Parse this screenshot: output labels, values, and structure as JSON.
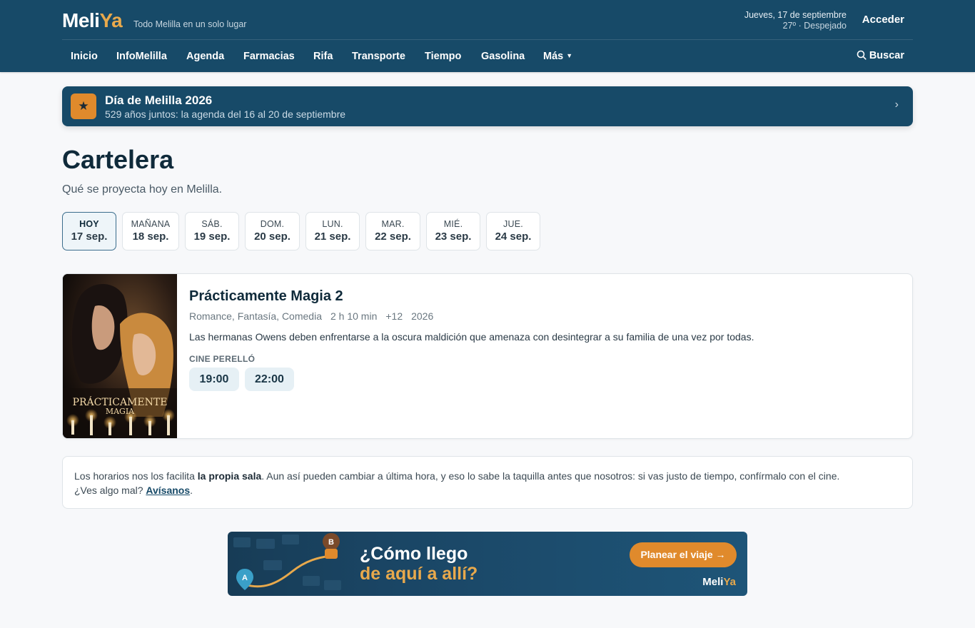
{
  "header": {
    "logo_part1": "Meli",
    "logo_part2": "Ya",
    "tagline": "Todo Melilla en un solo lugar",
    "date": "Jueves, 17 de septiembre",
    "weather": "27º · Despejado",
    "login": "Acceder",
    "search": "Buscar"
  },
  "nav": {
    "items": [
      "Inicio",
      "InfoMelilla",
      "Agenda",
      "Farmacias",
      "Rifa",
      "Transporte",
      "Tiempo",
      "Gasolina"
    ],
    "more": "Más"
  },
  "banner": {
    "title": "Día de Melilla 2026",
    "subtitle": "529 años juntos: la agenda del 16 al 20 de septiembre",
    "icon": "star-icon"
  },
  "page": {
    "title": "Cartelera",
    "subtitle": "Qué se proyecta hoy en Melilla."
  },
  "days": [
    {
      "label": "HOY",
      "date": "17 sep.",
      "active": true
    },
    {
      "label": "MAÑANA",
      "date": "18 sep."
    },
    {
      "label": "SÁB.",
      "date": "19 sep."
    },
    {
      "label": "DOM.",
      "date": "20 sep."
    },
    {
      "label": "LUN.",
      "date": "21 sep."
    },
    {
      "label": "MAR.",
      "date": "22 sep."
    },
    {
      "label": "MIÉ.",
      "date": "23 sep."
    },
    {
      "label": "JUE.",
      "date": "24 sep."
    }
  ],
  "movie": {
    "title": "Prácticamente Magia 2",
    "genres": "Romance, Fantasía, Comedia",
    "duration": "2 h 10 min",
    "rating": "+12",
    "year": "2026",
    "synopsis": "Las hermanas Owens deben enfrentarse a la oscura maldición que amenaza con desintegrar a su familia de una vez por todas.",
    "cinema": "CINE PERELLÓ",
    "times": [
      "19:00",
      "22:00"
    ],
    "poster_text1": "PRÁCTICAMENTE",
    "poster_text2": "MAGIA"
  },
  "note": {
    "part1": "Los horarios nos los facilita ",
    "bold": "la propia sala",
    "part2": ". Aun así pueden cambiar a última hora, y eso lo sabe la taquilla antes que nosotros: si vas justo de tiempo, confírmalo con el cine.",
    "part3": "¿Ves algo mal? ",
    "link": "Avísanos",
    "part4": "."
  },
  "ad": {
    "title1": "¿Cómo llego",
    "title2": "de aquí a allí?",
    "button": "Planear el viaje →",
    "logo_part1": "Meli",
    "logo_part2": "Ya",
    "pin_a": "A",
    "pin_b": "B"
  },
  "colors": {
    "header_bg": "#174a68",
    "accent_orange": "#e08a2c",
    "logo_gold": "#e8a94c"
  }
}
